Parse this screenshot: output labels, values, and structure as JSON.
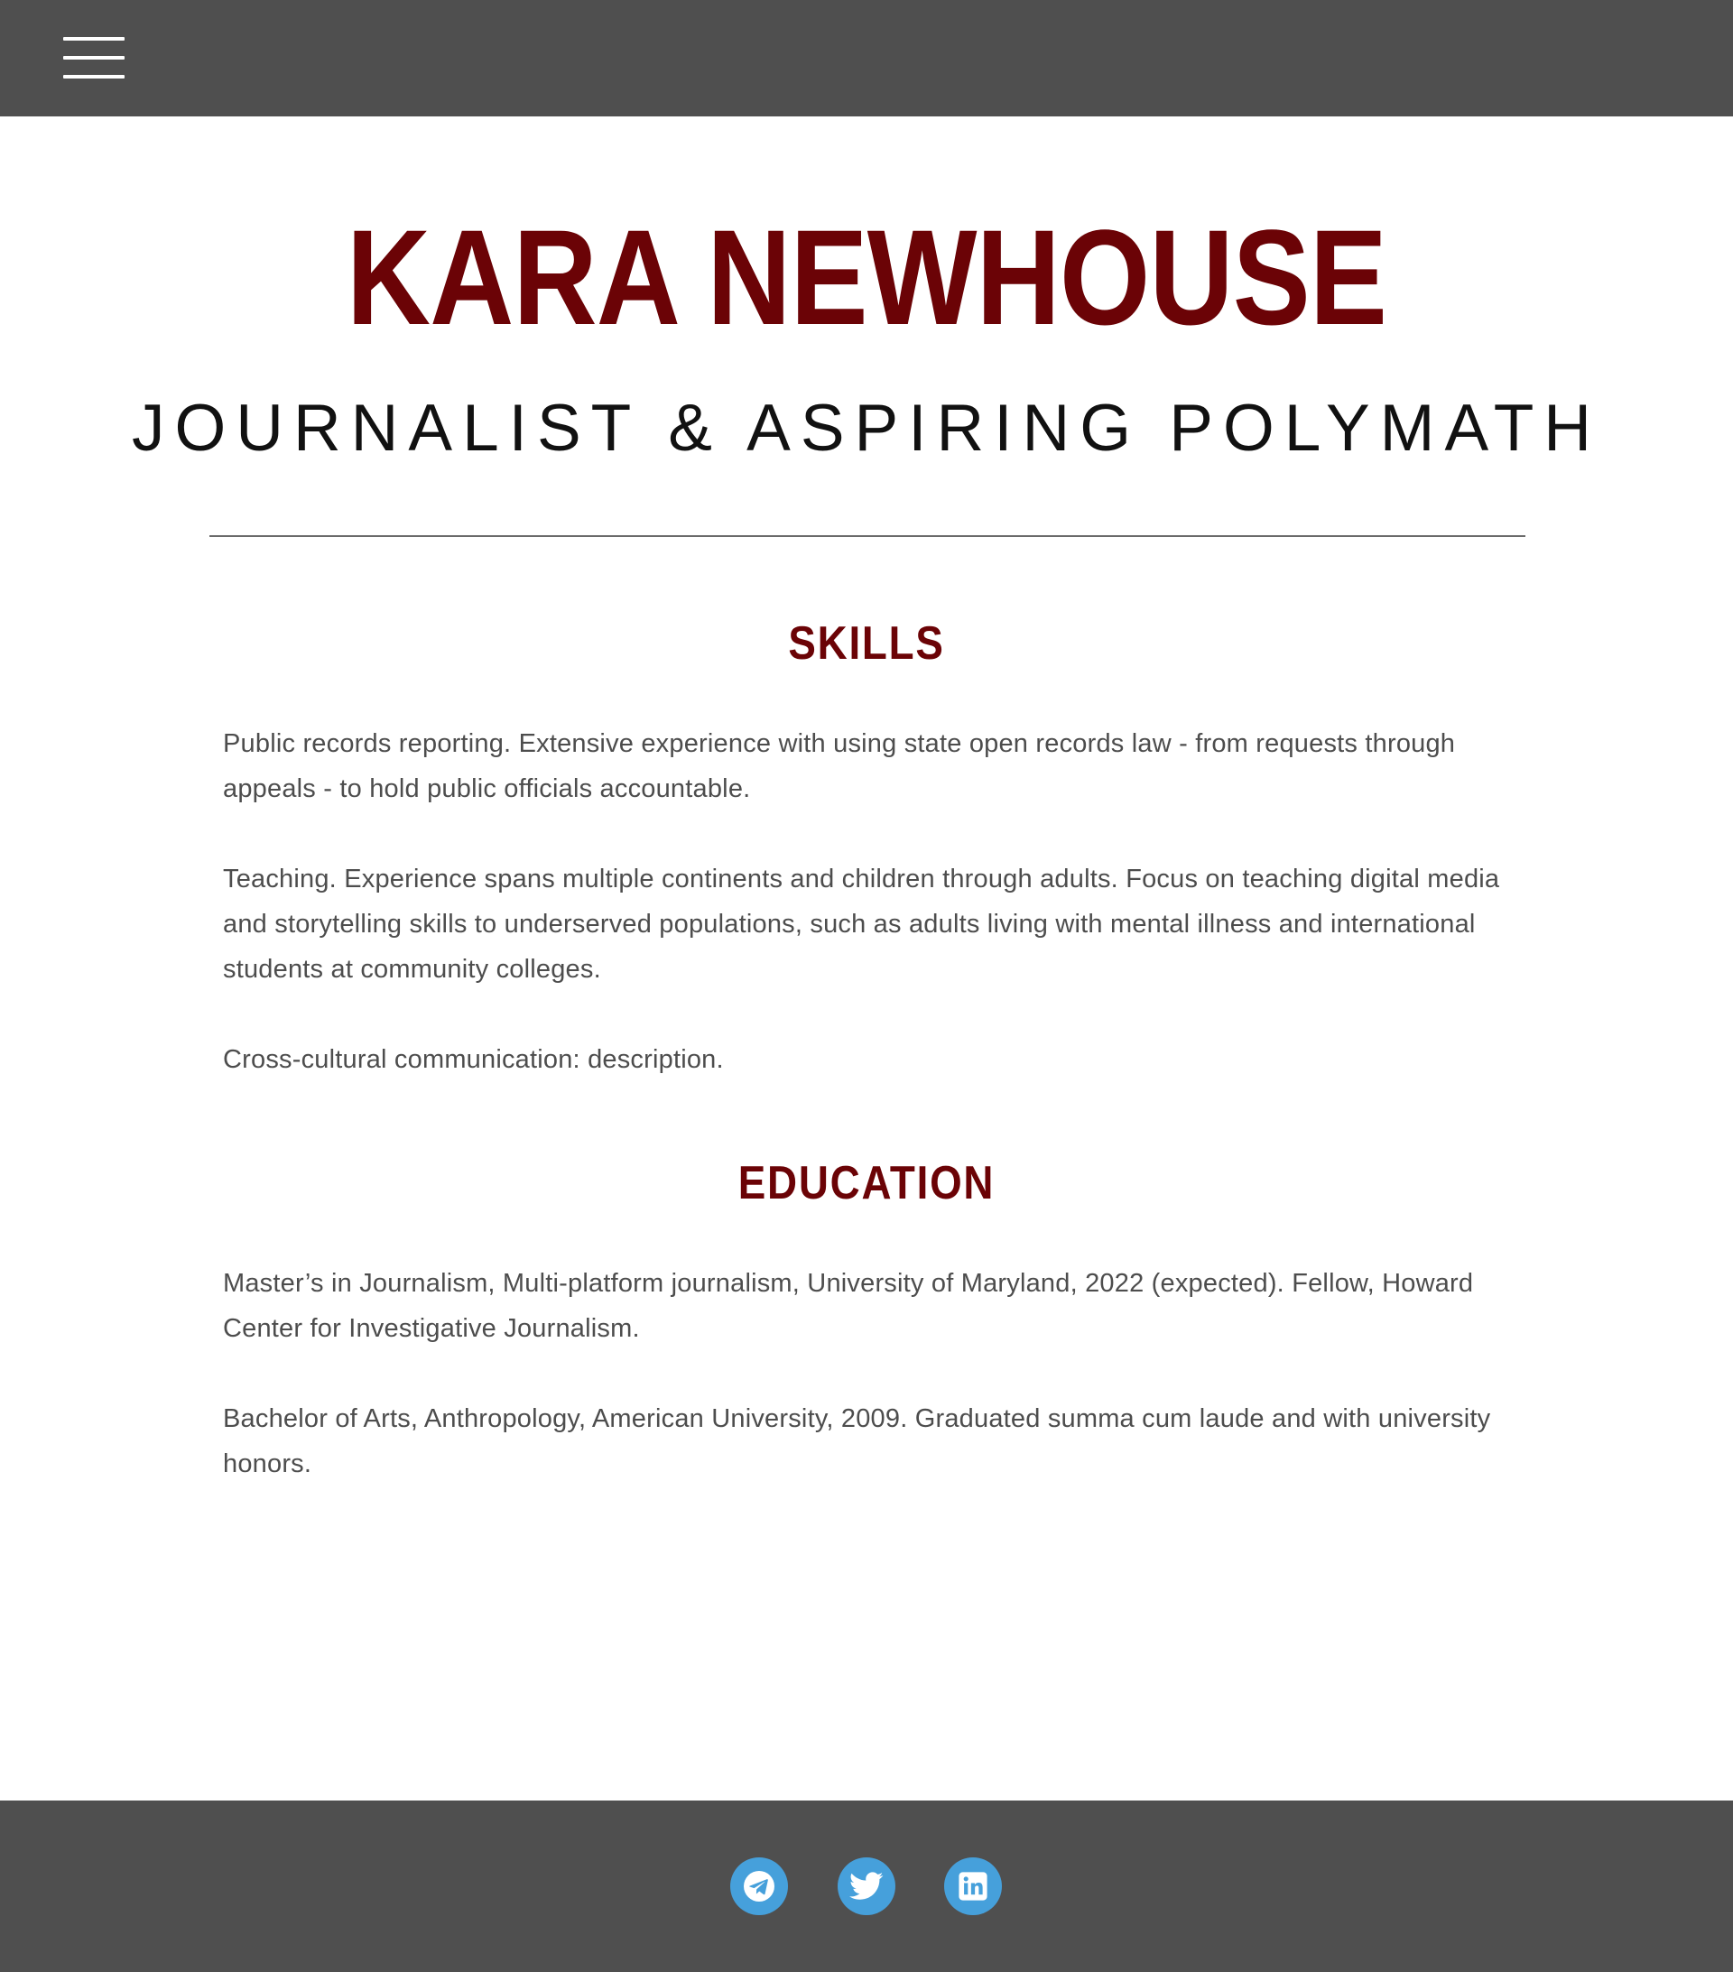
{
  "nav": {
    "menu_icon": "hamburger-menu-icon"
  },
  "header": {
    "name": "KARA NEWHOUSE",
    "tagline": "JOURNALIST & ASPIRING POLYMATH"
  },
  "skills": {
    "heading": "SKILLS",
    "paragraphs": [
      "Public records reporting. Extensive experience with using state open records law - from requests through appeals - to hold public officials accountable.",
      "Teaching. Experience spans multiple continents and children through adults. Focus on teaching digital media and storytelling skills to underserved populations, such as adults living with mental illness and international students at community colleges.",
      "Cross-cultural communication: description."
    ]
  },
  "education": {
    "heading": "EDUCATION",
    "paragraphs": [
      "Master’s in Journalism, Multi-platform journalism, University of Maryland, 2022 (expected). Fellow, Howard Center for Investigative Journalism.",
      "Bachelor of Arts, Anthropology, American University, 2009. Graduated summa cum laude and with university honors."
    ]
  },
  "footer": {
    "social_icons": [
      "telegram-icon",
      "twitter-icon",
      "linkedin-icon"
    ]
  },
  "colors": {
    "accent": "#6b0306",
    "bar": "#4f4f4f",
    "social": "#46a0db",
    "body_text": "#4d4d4d"
  }
}
